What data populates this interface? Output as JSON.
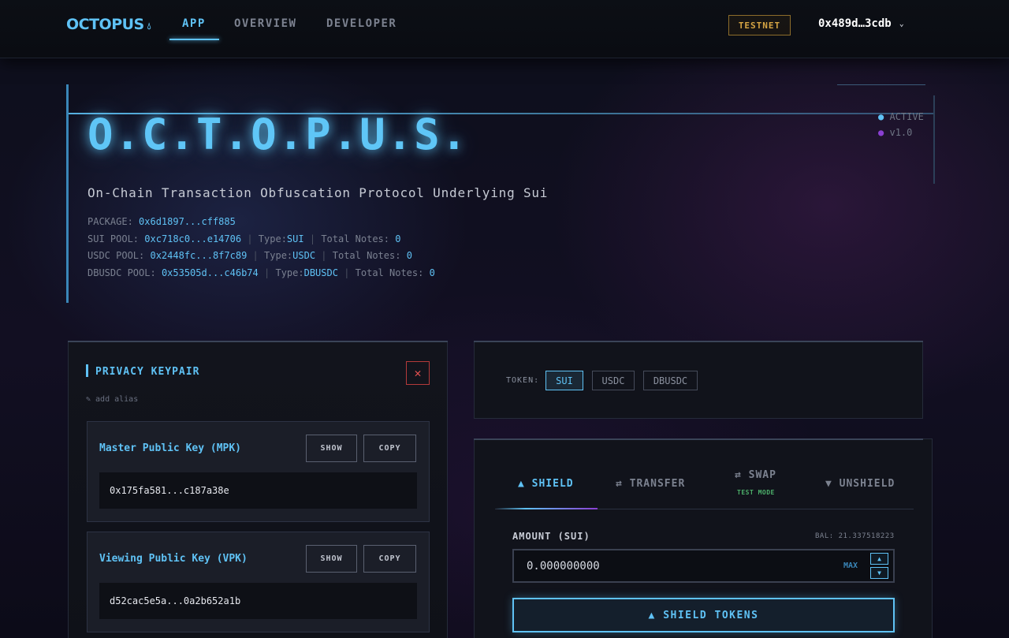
{
  "nav": {
    "logo": "OCTOPUS",
    "tabs": [
      "APP",
      "OVERVIEW",
      "DEVELOPER"
    ],
    "active_tab": "APP",
    "network": "TESTNET",
    "wallet": "0x489d…3cdb"
  },
  "hero": {
    "title": "O.C.T.O.P.U.S.",
    "subtitle": "On-Chain Transaction Obfuscation Protocol Underlying Sui",
    "status": "ACTIVE",
    "version": "v1.0",
    "package_label": "PACKAGE:",
    "package": "0x6d1897...cff885",
    "type_label": "Type:",
    "notes_label": "Total Notes:",
    "pools": [
      {
        "label": "SUI POOL:",
        "address": "0xc718c0...e14706",
        "type": "SUI",
        "notes": "0"
      },
      {
        "label": "USDC POOL:",
        "address": "0x2448fc...8f7c89",
        "type": "USDC",
        "notes": "0"
      },
      {
        "label": "DBUSDC POOL:",
        "address": "0x53505d...c46b74",
        "type": "DBUSDC",
        "notes": "0"
      }
    ]
  },
  "keypair": {
    "title": "PRIVACY KEYPAIR",
    "close": "✕",
    "alias": "✎ add alias",
    "show_label": "SHOW",
    "copy_label": "COPY",
    "keys": [
      {
        "label": "Master Public Key (MPK)",
        "value": "0x175fa581...c187a38e"
      },
      {
        "label": "Viewing Public Key (VPK)",
        "value": "d52cac5e5a...0a2b652a1b"
      }
    ]
  },
  "token": {
    "label": "TOKEN:",
    "options": [
      "SUI",
      "USDC",
      "DBUSDC"
    ],
    "selected": "SUI"
  },
  "action": {
    "tabs": [
      "▲ SHIELD",
      "⇄ TRANSFER",
      "⇄ SWAP",
      "▼ UNSHIELD"
    ],
    "swap_note": "TEST MODE",
    "amount_label": "AMOUNT (SUI)",
    "balance": "BAL: 21.337518223",
    "amount_value": "0.000000000",
    "max_label": "MAX",
    "submit_label": "▲ SHIELD TOKENS"
  },
  "colors": {
    "accent": "#5fc2f5",
    "warning": "#d6a544",
    "danger": "#e05050",
    "success": "#4caf6a",
    "purple": "#8a3fd2"
  }
}
